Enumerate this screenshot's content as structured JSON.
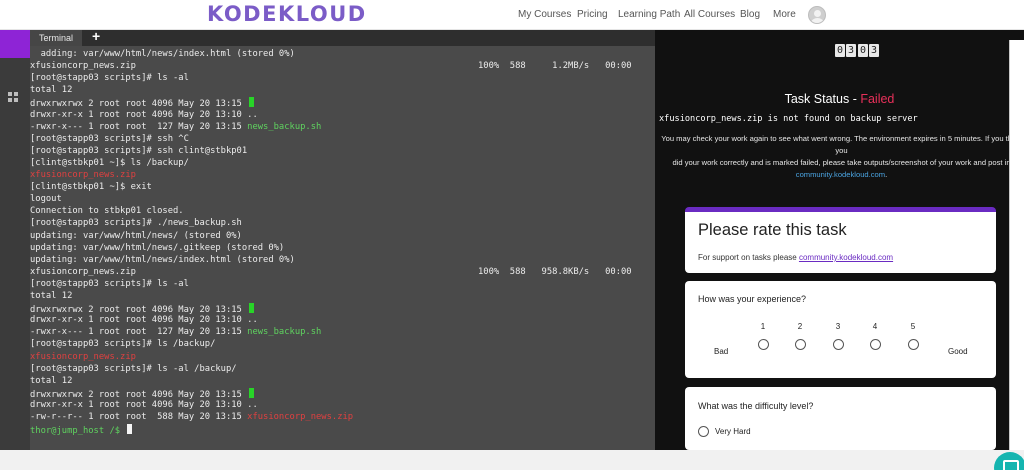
{
  "header": {
    "logo": "KODEKLOUD",
    "nav": [
      "My Courses",
      "Pricing",
      "Learning Path",
      "All Courses",
      "Blog",
      "More"
    ]
  },
  "terminal": {
    "tab_label": "Terminal",
    "add_tab": "+",
    "lines": [
      {
        "segs": [
          {
            "t": "  adding: var/www/html/news/index.html (stored 0%)"
          }
        ]
      },
      {
        "segs": [
          {
            "t": "xfusioncorp_news.zip"
          }
        ],
        "right": "100%  588     1.2MB/s   00:00"
      },
      {
        "segs": [
          {
            "t": "[root@stapp03 scripts]# ls -al"
          }
        ]
      },
      {
        "segs": [
          {
            "t": "total 12"
          }
        ]
      },
      {
        "segs": [
          {
            "t": "drwxrwxrwx 2 root root 4096 May 20 13:15 "
          }
        ],
        "cursor": "green"
      },
      {
        "segs": [
          {
            "t": "drwxr-xr-x 1 root root 4096 May 20 13:10 .."
          }
        ]
      },
      {
        "segs": [
          {
            "t": "-rwxr-x--- 1 root root  127 May 20 13:15 "
          },
          {
            "t": "news_backup.sh",
            "c": "green"
          }
        ]
      },
      {
        "segs": [
          {
            "t": "[root@stapp03 scripts]# ssh ^C"
          }
        ]
      },
      {
        "segs": [
          {
            "t": "[root@stapp03 scripts]# ssh clint@stbkp01"
          }
        ]
      },
      {
        "segs": [
          {
            "t": "[clint@stbkp01 ~]$ ls /backup/"
          }
        ]
      },
      {
        "segs": [
          {
            "t": "xfusioncorp_news.zip",
            "c": "red"
          }
        ]
      },
      {
        "segs": [
          {
            "t": "[clint@stbkp01 ~]$ exit"
          }
        ]
      },
      {
        "segs": [
          {
            "t": "logout"
          }
        ]
      },
      {
        "segs": [
          {
            "t": "Connection to stbkp01 closed."
          }
        ]
      },
      {
        "segs": [
          {
            "t": "[root@stapp03 scripts]# ./news_backup.sh"
          }
        ]
      },
      {
        "segs": [
          {
            "t": "updating: var/www/html/news/ (stored 0%)"
          }
        ]
      },
      {
        "segs": [
          {
            "t": "updating: var/www/html/news/.gitkeep (stored 0%)"
          }
        ]
      },
      {
        "segs": [
          {
            "t": "updating: var/www/html/news/index.html (stored 0%)"
          }
        ]
      },
      {
        "segs": [
          {
            "t": "xfusioncorp_news.zip"
          }
        ],
        "right": "100%  588   958.8KB/s   00:00"
      },
      {
        "segs": [
          {
            "t": "[root@stapp03 scripts]# ls -al"
          }
        ]
      },
      {
        "segs": [
          {
            "t": "total 12"
          }
        ]
      },
      {
        "segs": [
          {
            "t": "drwxrwxrwx 2 root root 4096 May 20 13:15 "
          }
        ],
        "cursor": "green"
      },
      {
        "segs": [
          {
            "t": "drwxr-xr-x 1 root root 4096 May 20 13:10 .."
          }
        ]
      },
      {
        "segs": [
          {
            "t": "-rwxr-x--- 1 root root  127 May 20 13:15 "
          },
          {
            "t": "news_backup.sh",
            "c": "green"
          }
        ]
      },
      {
        "segs": [
          {
            "t": "[root@stapp03 scripts]# ls /backup/"
          }
        ]
      },
      {
        "segs": [
          {
            "t": "xfusioncorp_news.zip",
            "c": "red"
          }
        ]
      },
      {
        "segs": [
          {
            "t": "[root@stapp03 scripts]# ls -al /backup/"
          }
        ]
      },
      {
        "segs": [
          {
            "t": "total 12"
          }
        ]
      },
      {
        "segs": [
          {
            "t": "drwxrwxrwx 2 root root 4096 May 20 13:15 "
          }
        ],
        "cursor": "green"
      },
      {
        "segs": [
          {
            "t": "drwxr-xr-x 1 root root 4096 May 20 13:10 .."
          }
        ]
      },
      {
        "segs": [
          {
            "t": "-rw-r--r-- 1 root root  588 May 20 13:15 "
          },
          {
            "t": "xfusioncorp_news.zip",
            "c": "red"
          }
        ]
      },
      {
        "segs": [
          {
            "t": "thor@jump_host /$ ",
            "c": "green"
          }
        ],
        "cursor": "white"
      }
    ]
  },
  "task": {
    "timer_digits": [
      "0",
      "3",
      "0",
      "3"
    ],
    "status_label": "Task Status - ",
    "status_value": "Failed",
    "error_message": "xfusioncorp_news.zip is not found on backup server",
    "info_line1": "You may check your work again to see what went wrong. The environment expires in 5 minutes. If you think you",
    "info_line2": "did your work correctly and is marked failed, please take outputs/screenshot of your work and post in",
    "info_link": "community.kodekloud.com",
    "info_end": "."
  },
  "rating": {
    "title": "Please rate this task",
    "support_prefix": "For support on tasks please ",
    "support_link": "community.kodekloud.com",
    "experience_question": "How was your experience?",
    "scale": [
      "1",
      "2",
      "3",
      "4",
      "5"
    ],
    "bad_label": "Bad",
    "good_label": "Good",
    "difficulty_question": "What was the difficulty level?",
    "difficulty_option": "Very Hard"
  }
}
